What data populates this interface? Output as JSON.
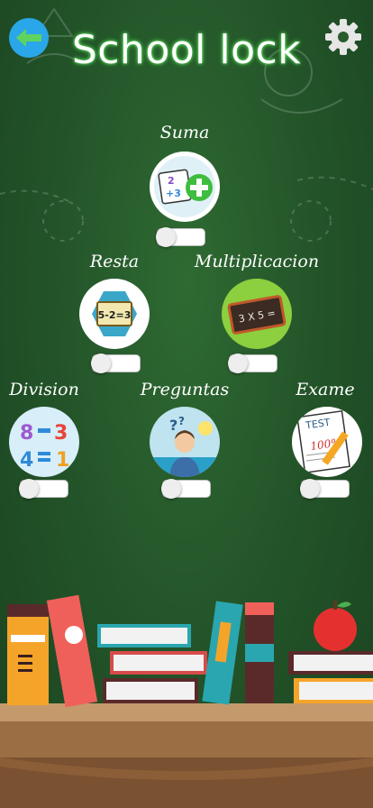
{
  "header": {
    "title": "School lock"
  },
  "modules": [
    {
      "label": "Suma",
      "enabled": false,
      "icon": "addition-cards-icon"
    },
    {
      "label": "Resta",
      "enabled": false,
      "icon": "subtraction-board-icon"
    },
    {
      "label": "Multiplicacion",
      "enabled": false,
      "icon": "multiplication-chalkboard-icon"
    },
    {
      "label": "Division",
      "enabled": false,
      "icon": "division-numbers-icon"
    },
    {
      "label": "Preguntas",
      "enabled": false,
      "icon": "thinking-person-icon"
    },
    {
      "label": "Exame",
      "enabled": false,
      "icon": "test-paper-icon"
    }
  ],
  "chalkboard_text": {
    "subtraction": "5-2=3",
    "multiplication": "3 X 5 =",
    "test": "TEST",
    "score": "100%"
  },
  "colors": {
    "background": "#24562a",
    "back_button": "#29a7e8",
    "title_glow": "#6ee86e",
    "gear": "#e6e6e6"
  }
}
